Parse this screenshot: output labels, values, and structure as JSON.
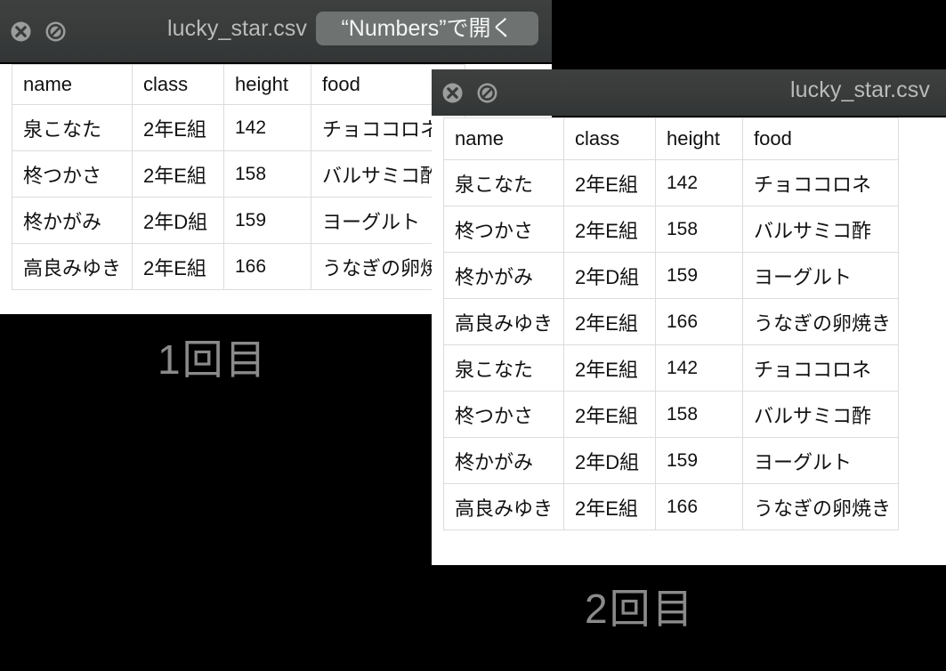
{
  "background_color": "#000000",
  "windows": [
    {
      "id": "one",
      "titlebar": {
        "title": "lucky_star.csv",
        "close_icon": "close-circle-icon",
        "block_icon": "no-entry-circle-icon",
        "action_label": "“Numbers”で開く"
      },
      "table": {
        "headers": [
          "name",
          "class",
          "height",
          "food"
        ],
        "rows": [
          [
            "泉こなた",
            "2年E組",
            "142",
            "チョココロネ"
          ],
          [
            "柊つかさ",
            "2年E組",
            "158",
            "バルサミコ酢"
          ],
          [
            "柊かがみ",
            "2年D組",
            "159",
            "ヨーグルト"
          ],
          [
            "高良みゆき",
            "2年E組",
            "166",
            "うなぎの卵焼き"
          ]
        ]
      },
      "caption": "1回目"
    },
    {
      "id": "two",
      "titlebar": {
        "title": "lucky_star.csv",
        "close_icon": "close-circle-icon",
        "block_icon": "no-entry-circle-icon"
      },
      "table": {
        "headers": [
          "name",
          "class",
          "height",
          "food"
        ],
        "rows": [
          [
            "泉こなた",
            "2年E組",
            "142",
            "チョココロネ"
          ],
          [
            "柊つかさ",
            "2年E組",
            "158",
            "バルサミコ酢"
          ],
          [
            "柊かがみ",
            "2年D組",
            "159",
            "ヨーグルト"
          ],
          [
            "高良みゆき",
            "2年E組",
            "166",
            "うなぎの卵焼き"
          ],
          [
            "泉こなた",
            "2年E組",
            "142",
            "チョココロネ"
          ],
          [
            "柊つかさ",
            "2年E組",
            "158",
            "バルサミコ酢"
          ],
          [
            "柊かがみ",
            "2年D組",
            "159",
            "ヨーグルト"
          ],
          [
            "高良みゆき",
            "2年E組",
            "166",
            "うなぎの卵焼き"
          ]
        ]
      },
      "caption": "2回目"
    }
  ]
}
